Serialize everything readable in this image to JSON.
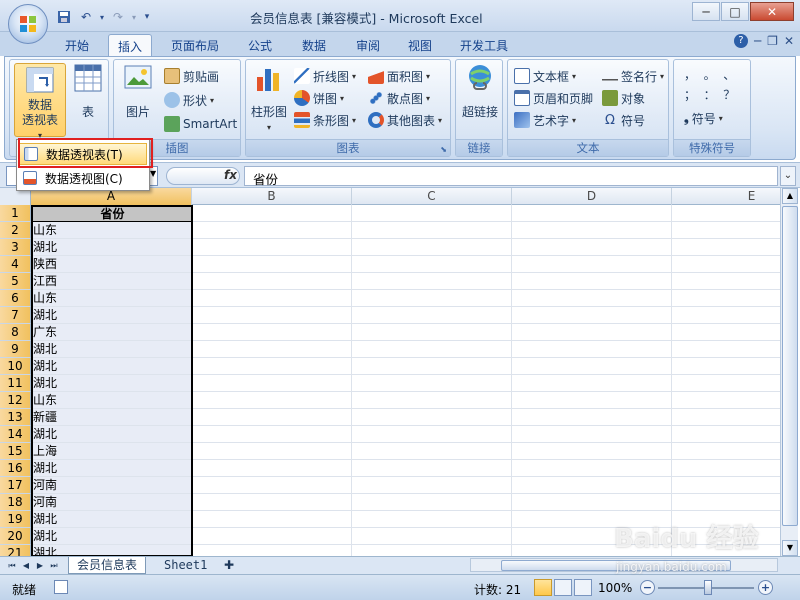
{
  "window": {
    "title": "会员信息表  [兼容模式] - Microsoft Excel",
    "controls": [
      "minimize",
      "maximize",
      "close"
    ]
  },
  "quick_access": [
    "save-icon",
    "undo-icon",
    "redo-icon",
    "customize-icon"
  ],
  "tabs": [
    {
      "label": "开始",
      "active": false
    },
    {
      "label": "插入",
      "active": true
    },
    {
      "label": "页面布局",
      "active": false
    },
    {
      "label": "公式",
      "active": false
    },
    {
      "label": "数据",
      "active": false
    },
    {
      "label": "审阅",
      "active": false
    },
    {
      "label": "视图",
      "active": false
    },
    {
      "label": "开发工具",
      "active": false
    }
  ],
  "ribbon": {
    "tables_group": {
      "pivot_line1": "数据",
      "pivot_line2": "透视表",
      "table": "表"
    },
    "illustrations": {
      "label": "插图",
      "picture": "图片",
      "clipart": "剪贴画",
      "shapes": "形状",
      "smartart": "SmartArt"
    },
    "charts": {
      "label": "图表",
      "column": "柱形图",
      "line": "折线图",
      "pie": "饼图",
      "bar": "条形图",
      "area": "面积图",
      "scatter": "散点图",
      "other": "其他图表"
    },
    "links": {
      "label": "链接",
      "hyperlink": "超链接"
    },
    "text": {
      "label": "文本",
      "textbox": "文本框",
      "header_footer": "页眉和页脚",
      "wordart": "艺术字",
      "signature": "签名行",
      "object": "对象",
      "symbol": "符号"
    },
    "special": {
      "label": "特殊符号",
      "symbol": "符号",
      "chars_row1": "，  。  、",
      "chars_row2": "；  ：  ？"
    }
  },
  "pivot_menu": {
    "items": [
      "数据透视表(T)",
      "数据透视图(C)"
    ],
    "highlighted": 0
  },
  "formula_bar": {
    "name_box": "",
    "fx": "fx",
    "content": "省份"
  },
  "sheet": {
    "columns": [
      "A",
      "B",
      "C",
      "D",
      "E"
    ],
    "selected_column": "A",
    "rows": [
      {
        "n": "1",
        "a": "省份"
      },
      {
        "n": "2",
        "a": "山东"
      },
      {
        "n": "3",
        "a": "湖北"
      },
      {
        "n": "4",
        "a": "陕西"
      },
      {
        "n": "5",
        "a": "江西"
      },
      {
        "n": "6",
        "a": "山东"
      },
      {
        "n": "7",
        "a": "湖北"
      },
      {
        "n": "8",
        "a": "广东"
      },
      {
        "n": "9",
        "a": "湖北"
      },
      {
        "n": "10",
        "a": "湖北"
      },
      {
        "n": "11",
        "a": "湖北"
      },
      {
        "n": "12",
        "a": "山东"
      },
      {
        "n": "13",
        "a": "新疆"
      },
      {
        "n": "14",
        "a": "湖北"
      },
      {
        "n": "15",
        "a": "上海"
      },
      {
        "n": "16",
        "a": "湖北"
      },
      {
        "n": "17",
        "a": "河南"
      },
      {
        "n": "18",
        "a": "河南"
      },
      {
        "n": "19",
        "a": "湖北"
      },
      {
        "n": "20",
        "a": "湖北"
      },
      {
        "n": "21",
        "a": "湖北"
      }
    ]
  },
  "sheet_tabs": [
    {
      "label": "会员信息表",
      "active": true
    },
    {
      "label": "Sheet1",
      "active": false
    }
  ],
  "status": {
    "ready": "就绪",
    "count": "计数: 21",
    "zoom": "100%"
  },
  "watermark": {
    "logo": "Baidu 经验",
    "url": "jingyan.baidu.com"
  },
  "colors": {
    "accent_tab": "#15428b",
    "selection_header": "#f1c15f",
    "menu_highlight": "#ffd97a",
    "red_box": "#e02020"
  }
}
